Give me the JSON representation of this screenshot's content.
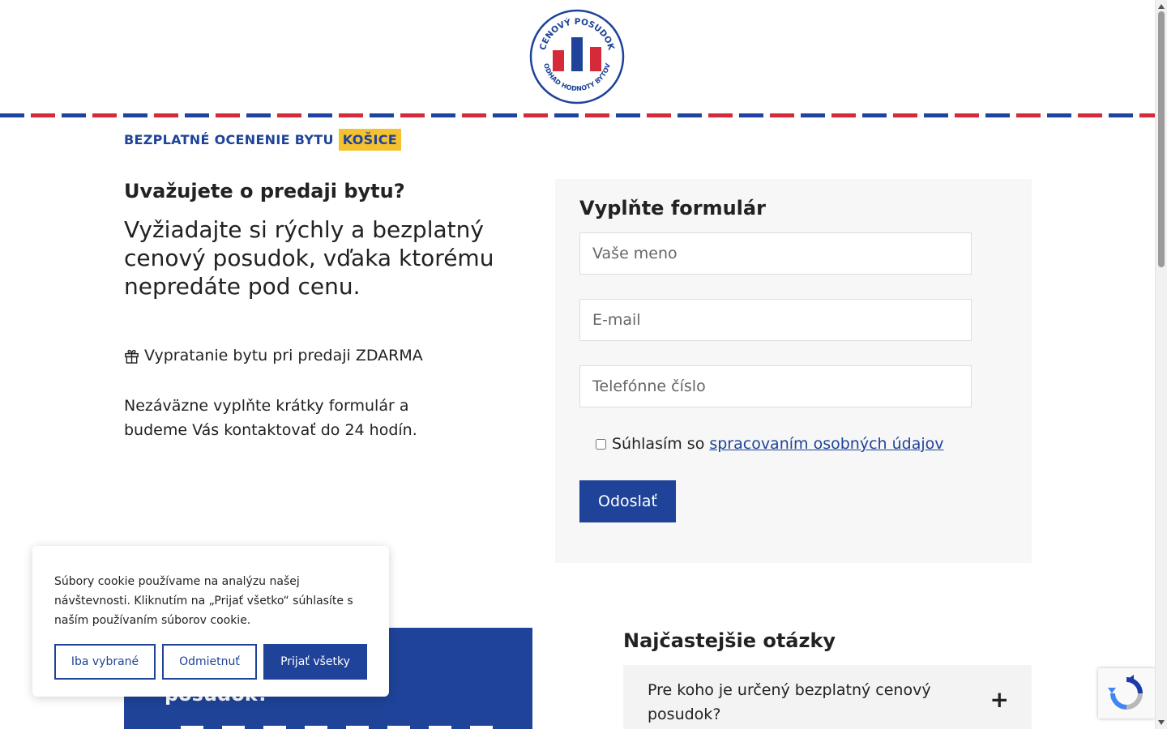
{
  "header": {
    "logo": {
      "top_text": "CENOVÝ POSUDOK",
      "bottom_text": "ODHAD HODNOTY BYTOV",
      "colors": {
        "blue": "#1e4398",
        "red": "#d52a3a"
      }
    }
  },
  "tagline": {
    "label": "BEZPLATNÉ OCENENIE BYTU",
    "city": "KOŠICE"
  },
  "hero": {
    "question": "Uvažujete o predaji bytu?",
    "lead": "Vyžiadajte si rýchly a bezplatný cenový posudok, vďaka ktorému nepredáte pod cenu.",
    "gift_text": "Vypratanie bytu pri predaji ZDARMA",
    "gift_icon": "gift-icon",
    "note": "Nezáväzne vyplňte krátky formulár a budeme Vás kontaktovať do 24 hodín."
  },
  "form": {
    "title": "Vyplňte formulár",
    "name_placeholder": "Vaše meno",
    "email_placeholder": "E-mail",
    "phone_placeholder": "Telefónne číslo",
    "consent_text": "Súhlasím so",
    "consent_link": "spracovaním osobných údajov",
    "submit_label": "Odoslať"
  },
  "blue_box": {
    "text": "posudok?"
  },
  "faq": {
    "title": "Najčastejšie otázky",
    "items": [
      {
        "question": "Pre koho je určený bezplatný cenový posudok?",
        "toggle": "+"
      }
    ]
  },
  "cookie_banner": {
    "message": "Súbory cookie používame na analýzu našej návštevnosti. Kliknutím na „Prijať všetko“ súhlasíte s naším používaním súborov cookie.",
    "buttons": {
      "selected": "Iba vybrané",
      "reject": "Odmietnuť",
      "accept": "Prijať všetky"
    }
  },
  "theme": {
    "brand_blue": "#1e4398",
    "accent_yellow": "#f6c12e",
    "brand_red": "#d52a3a"
  }
}
